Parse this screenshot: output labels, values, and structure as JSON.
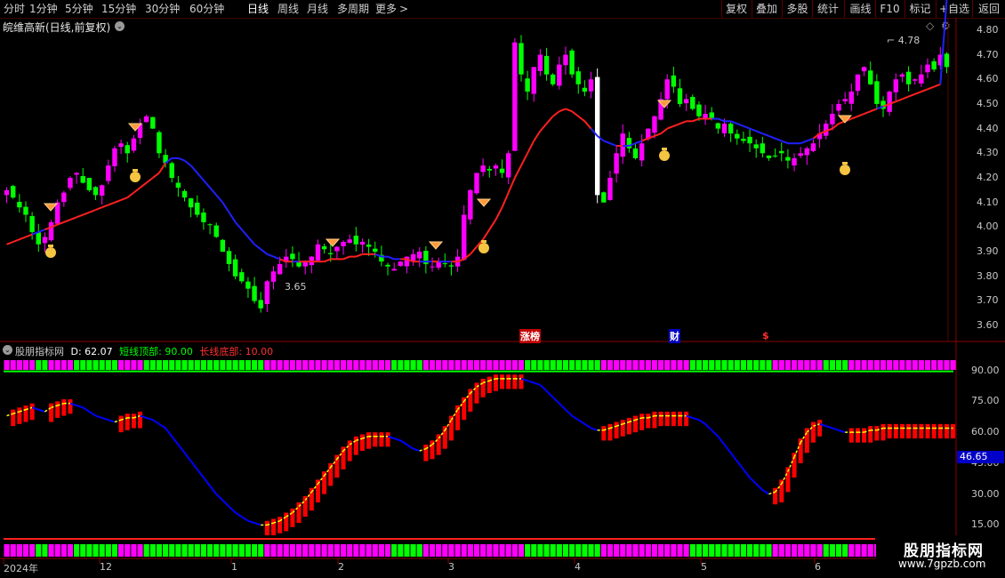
{
  "toolbar": {
    "periods": [
      {
        "label": "分时",
        "active": false
      },
      {
        "label": "1分钟",
        "active": false
      },
      {
        "label": "5分钟",
        "active": false
      },
      {
        "label": "15分钟",
        "active": false
      },
      {
        "label": "30分钟",
        "active": false
      },
      {
        "label": "60分钟",
        "active": false
      },
      {
        "label": "日线",
        "active": true
      },
      {
        "label": "周线",
        "active": false
      },
      {
        "label": "月线",
        "active": false
      },
      {
        "label": "多周期",
        "active": false
      },
      {
        "label": "更多",
        "active": false
      }
    ],
    "more_arrow": ">",
    "right_buttons": [
      "复权",
      "叠加",
      "多股",
      "统计",
      "画线",
      "F10",
      "标记",
      "+自选",
      "返回"
    ]
  },
  "stock": {
    "title": "皖维高新(日线,前复权)"
  },
  "price_axis": {
    "labels": [
      "4.80",
      "4.70",
      "4.60",
      "4.50",
      "4.40",
      "4.30",
      "4.20",
      "4.10",
      "4.00",
      "3.90",
      "3.80",
      "3.70",
      "3.60"
    ]
  },
  "annotations": {
    "high_label": "4.78",
    "low_label": "3.65",
    "events": [
      {
        "text": "涨榜",
        "color": "#ffffff",
        "bg": "#c00000"
      },
      {
        "text": "财",
        "color": "#ffffff",
        "bg": "#0000c0"
      },
      {
        "text": "$",
        "color": "#ff3030"
      }
    ]
  },
  "indicator": {
    "name": "股朋指标网",
    "d_label": "D: 62.07",
    "top_label": "短线顶部: 90.00",
    "bottom_label": "长线底部: 10.00",
    "current_value": "46.65",
    "axis_labels": [
      "90.00",
      "75.00",
      "60.00",
      "45.00",
      "30.00",
      "15.00"
    ],
    "colors": {
      "d": "#ffffff",
      "top": "#00ff00",
      "bottom": "#ff3030",
      "name": "#c8c8c8"
    }
  },
  "date_axis": {
    "labels": [
      "2024年",
      "12",
      "1",
      "2",
      "3",
      "4",
      "5",
      "6"
    ]
  },
  "watermark": {
    "line1": "股朋指标网",
    "line2": "www.7gpzb.com"
  },
  "colors": {
    "up": "#ff00ff",
    "down": "#00ff00",
    "ma_red": "#ff2020",
    "ma_blue": "#2020ff",
    "osc_bar": "#ff0000",
    "osc_line": "#ffff00",
    "osc_down": "#0000ff"
  },
  "chart_data": {
    "type": "candlestick",
    "price_range": [
      3.55,
      4.85
    ],
    "closes": [
      4.15,
      4.12,
      4.08,
      4.05,
      3.98,
      3.93,
      3.96,
      4.02,
      4.1,
      4.14,
      4.2,
      4.22,
      4.18,
      4.15,
      4.13,
      4.17,
      4.25,
      4.32,
      4.34,
      4.3,
      4.36,
      4.42,
      4.45,
      4.4,
      4.3,
      4.26,
      4.2,
      4.16,
      4.12,
      4.08,
      4.05,
      4.02,
      4.01,
      3.96,
      3.9,
      3.85,
      3.8,
      3.78,
      3.75,
      3.7,
      3.67,
      3.78,
      3.82,
      3.85,
      3.88,
      3.87,
      3.84,
      3.86,
      3.88,
      3.93,
      3.91,
      3.89,
      3.92,
      3.94,
      3.95,
      3.93,
      3.94,
      3.92,
      3.9,
      3.86,
      3.84,
      3.83,
      3.86,
      3.88,
      3.89,
      3.9,
      3.85,
      3.84,
      3.86,
      3.85,
      3.84,
      3.88,
      4.05,
      4.15,
      4.22,
      4.25,
      4.23,
      4.25,
      4.22,
      4.3,
      4.75,
      4.62,
      4.55,
      4.65,
      4.7,
      4.62,
      4.58,
      4.66,
      4.7,
      4.62,
      4.58,
      4.55,
      4.6,
      4.13,
      4.1,
      4.2,
      4.3,
      4.38,
      4.32,
      4.28,
      4.34,
      4.4,
      4.45,
      4.52,
      4.6,
      4.57,
      4.5,
      4.52,
      4.48,
      4.45,
      4.46,
      4.44,
      4.4,
      4.42,
      4.38,
      4.36,
      4.35,
      4.34,
      4.32,
      4.3,
      4.28,
      4.29,
      4.3,
      4.27,
      4.28,
      4.3,
      4.32,
      4.34,
      4.38,
      4.42,
      4.46,
      4.5,
      4.52,
      4.55,
      4.62,
      4.65,
      4.58,
      4.5,
      4.48,
      4.55,
      4.6,
      4.62,
      4.58,
      4.6,
      4.62,
      4.66,
      4.64,
      4.7,
      4.65
    ],
    "ma_long": [
      3.93,
      3.94,
      3.95,
      3.96,
      3.97,
      3.98,
      3.99,
      4.0,
      4.01,
      4.02,
      4.03,
      4.04,
      4.05,
      4.06,
      4.07,
      4.08,
      4.09,
      4.1,
      4.11,
      4.12,
      4.14,
      4.16,
      4.18,
      4.2,
      4.22,
      4.26,
      4.28,
      4.28,
      4.27,
      4.25,
      4.22,
      4.19,
      4.16,
      4.13,
      4.1,
      4.06,
      4.02,
      3.99,
      3.96,
      3.93,
      3.91,
      3.89,
      3.88,
      3.87,
      3.86,
      3.86,
      3.86,
      3.86,
      3.86,
      3.86,
      3.86,
      3.87,
      3.87,
      3.87,
      3.88,
      3.88,
      3.89,
      3.89,
      3.89,
      3.88,
      3.88,
      3.87,
      3.87,
      3.87,
      3.86,
      3.86,
      3.86,
      3.86,
      3.86,
      3.86,
      3.86,
      3.86,
      3.87,
      3.89,
      3.92,
      3.95,
      3.99,
      4.03,
      4.08,
      4.14,
      4.2,
      4.25,
      4.3,
      4.35,
      4.39,
      4.42,
      4.45,
      4.47,
      4.48,
      4.47,
      4.45,
      4.43,
      4.4,
      4.37,
      4.35,
      4.34,
      4.33,
      4.33,
      4.33,
      4.34,
      4.35,
      4.36,
      4.37,
      4.38,
      4.4,
      4.41,
      4.42,
      4.43,
      4.43,
      4.44,
      4.44,
      4.44,
      4.44,
      4.43,
      4.43,
      4.42,
      4.41,
      4.4,
      4.39,
      4.38,
      4.37,
      4.36,
      4.35,
      4.34,
      4.34,
      4.34,
      4.35,
      4.36,
      4.38,
      4.39,
      4.4,
      4.42,
      4.43,
      4.44,
      4.45,
      4.46,
      4.47,
      4.48,
      4.49,
      4.5,
      4.51,
      4.52,
      4.53,
      4.54,
      4.55,
      4.56,
      4.57,
      4.58
    ],
    "oscillator_D": [
      68,
      69,
      70,
      71,
      72,
      71,
      70,
      72,
      73,
      74,
      74,
      73,
      72,
      70,
      68,
      67,
      66,
      65,
      66,
      67,
      67,
      68,
      67,
      66,
      64,
      62,
      58,
      54,
      50,
      46,
      42,
      38,
      34,
      30,
      27,
      24,
      21,
      19,
      17,
      16,
      15,
      15,
      16,
      17,
      19,
      21,
      24,
      27,
      31,
      35,
      39,
      43,
      47,
      51,
      54,
      56,
      57,
      58,
      58,
      58,
      58,
      57,
      56,
      54,
      52,
      51,
      52,
      54,
      57,
      61,
      66,
      71,
      75,
      79,
      82,
      84,
      85,
      86,
      86,
      86,
      86,
      86,
      85,
      84,
      83,
      80,
      77,
      74,
      71,
      68,
      66,
      64,
      62,
      61,
      61,
      62,
      63,
      64,
      65,
      66,
      67,
      67,
      68,
      68,
      68,
      68,
      68,
      68,
      67,
      66,
      64,
      61,
      58,
      54,
      50,
      46,
      42,
      38,
      35,
      32,
      30,
      31,
      35,
      41,
      48,
      55,
      60,
      63,
      64,
      63,
      62,
      61,
      60,
      60,
      60,
      60,
      61,
      61,
      62,
      62,
      62,
      62,
      62,
      62,
      62,
      62,
      62,
      62,
      62,
      62
    ],
    "ylim": [
      10,
      95
    ],
    "levels": {
      "top": 90,
      "bottom": 10
    }
  }
}
